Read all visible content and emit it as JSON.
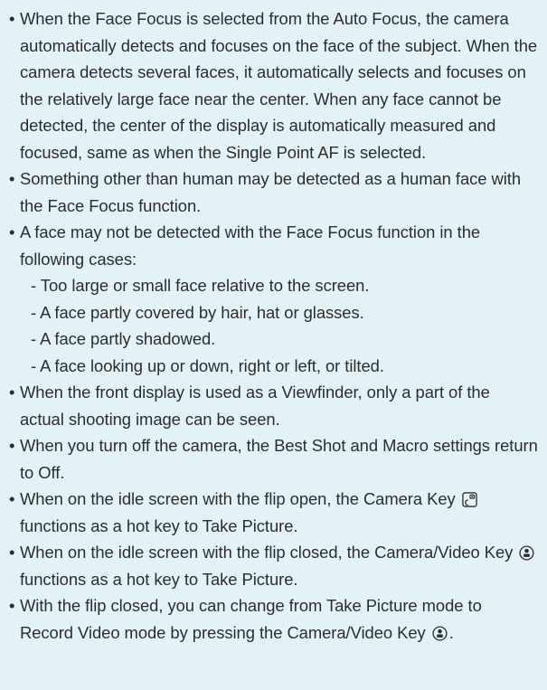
{
  "bullet_char": "•",
  "items": [
    {
      "text": "When the Face Focus is selected from the Auto Focus, the camera automatically detects and focuses on the face of the subject. When the camera detects several faces, it automatically selects and focuses on the relatively large face near the center. When any face cannot be detected, the center of the display is automatically measured and focused, same as when the Single Point AF is selected."
    },
    {
      "text": "Something other than human may be detected as a human face with the Face Focus function."
    },
    {
      "text": "A face may not be detected with the Face Focus function in the following cases:",
      "subitems": [
        "- Too large or small face relative to the screen.",
        "- A face partly covered by hair, hat or glasses.",
        "- A face partly shadowed.",
        "- A face looking up or down, right or left, or tilted."
      ]
    },
    {
      "text": "When the front display is used as a Viewfinder, only a part of the actual shooting image can be seen."
    },
    {
      "text": "When you turn off the camera, the Best Shot and Macro settings return to Off."
    },
    {
      "text_before": "When on the idle screen with the flip open, the Camera Key",
      "icon": "camera-key-icon",
      "text_after": "functions as a hot key to Take Picture."
    },
    {
      "text_before": "When on the idle screen with the flip closed, the Camera/Video Key",
      "icon": "camera-video-key-icon",
      "text_after": "functions as a hot key to Take Picture."
    },
    {
      "text_before": "With the flip closed, you can change from Take Picture mode to Record Video mode by pressing the Camera/Video Key",
      "icon": "camera-video-key-icon",
      "text_after": "."
    }
  ]
}
